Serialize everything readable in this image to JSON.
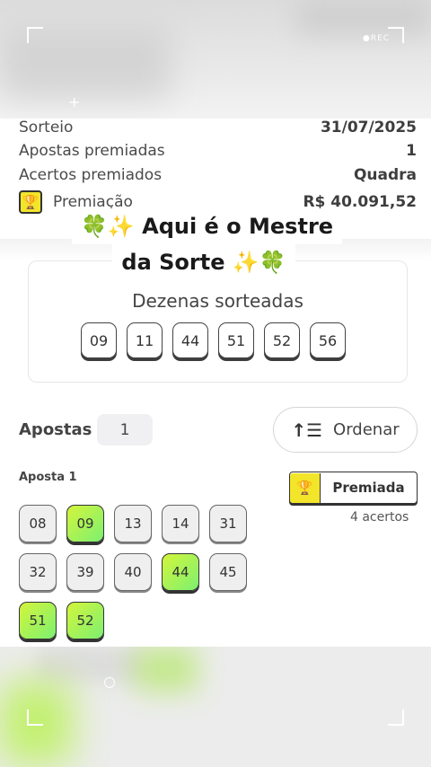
{
  "overlay": {
    "rec_label": "●REC"
  },
  "summary": {
    "rows": [
      {
        "label": "Sorteio",
        "value": "31/07/2025"
      },
      {
        "label": "Apostas premiadas",
        "value": "1"
      },
      {
        "label": "Acertos premiados",
        "value": "Quadra"
      },
      {
        "label": "Premiação",
        "value": "R$ 40.091,52",
        "icon": "trophy-icon"
      }
    ]
  },
  "caption": {
    "line1": "🍀✨ Aqui é o Mestre",
    "line2": "da Sorte ✨🍀"
  },
  "draw": {
    "title": "Dezenas sorteadas",
    "numbers": [
      "09",
      "11",
      "44",
      "51",
      "52",
      "56"
    ]
  },
  "bets": {
    "label": "Apostas",
    "count": "1",
    "sort_label": "Ordenar",
    "sort_icon": "sort-descending-icon"
  },
  "bet1": {
    "title": "Aposta 1",
    "badge_label": "Premiada",
    "badge_icon": "trophy-icon",
    "hits_text": "4 acertos",
    "numbers": [
      {
        "n": "08",
        "hit": false
      },
      {
        "n": "09",
        "hit": true
      },
      {
        "n": "13",
        "hit": false
      },
      {
        "n": "14",
        "hit": false
      },
      {
        "n": "31",
        "hit": false
      },
      {
        "n": "32",
        "hit": false
      },
      {
        "n": "39",
        "hit": false
      },
      {
        "n": "40",
        "hit": false
      },
      {
        "n": "44",
        "hit": true
      },
      {
        "n": "45",
        "hit": false
      },
      {
        "n": "51",
        "hit": true
      },
      {
        "n": "52",
        "hit": true
      }
    ]
  },
  "colors": {
    "hit_gradient_start": "#d4f53c",
    "hit_gradient_end": "#7cf070",
    "trophy_bg": "#f2e52a"
  }
}
